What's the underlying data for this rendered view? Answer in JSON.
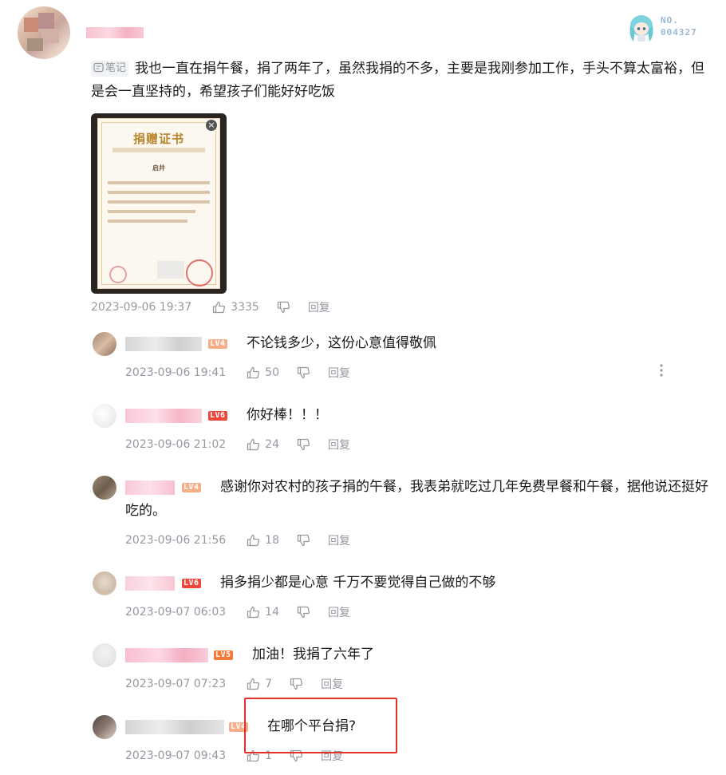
{
  "main_comment": {
    "note_tag": "笔记",
    "text": "我也一直在捐午餐，捐了两年了，虽然我捐的不多，主要是我刚参加工作，手头不算太富裕，但是会一直坚持的，希望孩子们能好好吃饭",
    "badge": {
      "no_label": "NO.",
      "number": "004327"
    },
    "certificate": {
      "title": "捐赠证书",
      "name": "启井"
    },
    "time": "2023-09-06 19:37",
    "likes": "3335",
    "reply_label": "回复"
  },
  "replies": [
    {
      "level": "LV4",
      "level_color": "#f6ad88",
      "text": "不论钱多少，这份心意值得敬佩",
      "time": "2023-09-06 19:41",
      "likes": "50",
      "reply_label": "回复"
    },
    {
      "level": "LV6",
      "level_color": "#f0473c",
      "text": "你好棒！！！",
      "time": "2023-09-06 21:02",
      "likes": "24",
      "reply_label": "回复"
    },
    {
      "level": "LV4",
      "level_color": "#f6ad88",
      "text": "感谢你对农村的孩子捐的午餐，我表弟就吃过几年免费早餐和午餐，据他说还挺好吃的。",
      "time": "2023-09-06 21:56",
      "likes": "18",
      "reply_label": "回复"
    },
    {
      "level": "LV6",
      "level_color": "#f0473c",
      "text": "捐多捐少都是心意 千万不要觉得自己做的不够",
      "time": "2023-09-07 06:03",
      "likes": "14",
      "reply_label": "回复"
    },
    {
      "level": "LV5",
      "level_color": "#f57a3a",
      "text": "加油！我捐了六年了",
      "time": "2023-09-07 07:23",
      "likes": "7",
      "reply_label": "回复"
    },
    {
      "level": "LV4",
      "level_color": "#f6ad88",
      "text": "在哪个平台捐?",
      "time": "2023-09-07 09:43",
      "likes": "1",
      "reply_label": "回复"
    }
  ],
  "colors": {
    "meta_gray": "#9499a0",
    "text": "#18191c",
    "highlight": "#e0312b"
  }
}
